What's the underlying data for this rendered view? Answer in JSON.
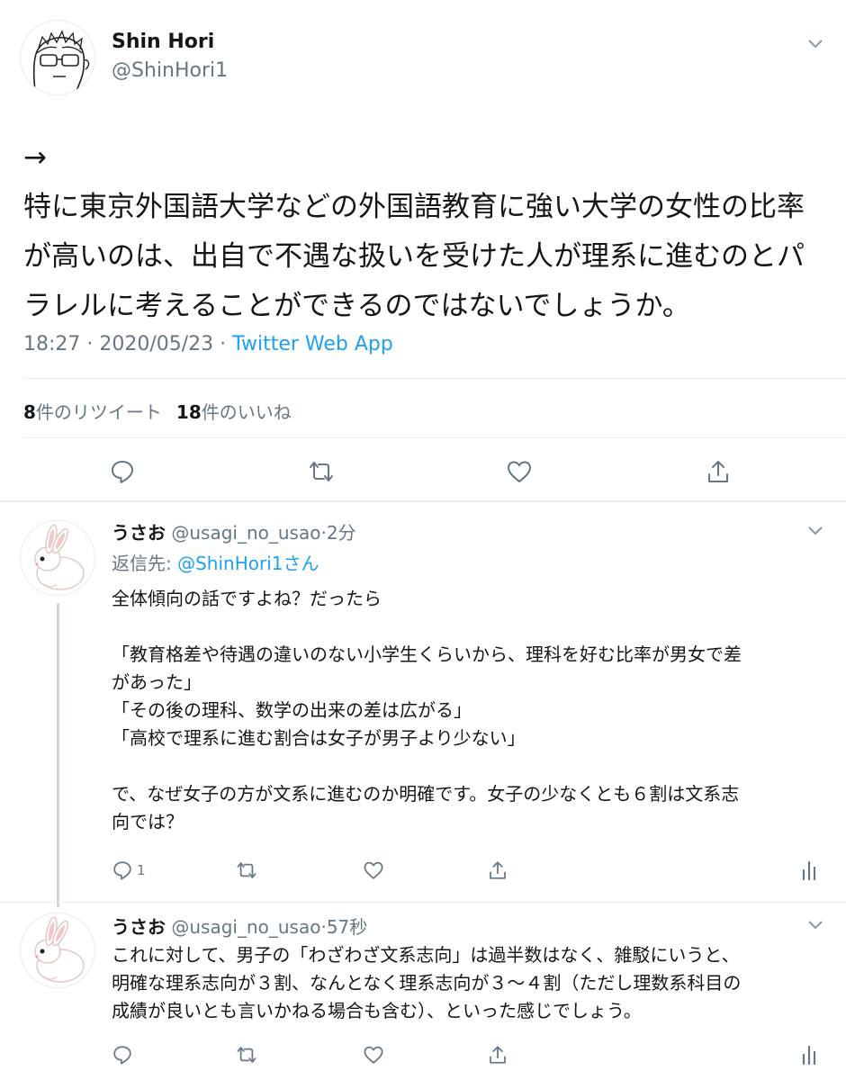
{
  "main_tweet": {
    "author_name": "Shin Hori",
    "author_handle": "@ShinHori1",
    "text_lines": [
      "→",
      "特に東京外国語大学などの外国語教育に強い大学の女性の比率",
      "が高いのは、出自で不遇な扱いを受けた人が理系に進むのとパ",
      "ラレルに考えることができるのではないでしょうか。"
    ],
    "timestamp": "18:27 · 2020/05/23 · ",
    "source_app": "Twitter Web App",
    "retweet_count": "8",
    "retweet_label": "件のリツイート",
    "like_count": "18",
    "like_label": "件のいいね"
  },
  "replies": [
    {
      "author_name": "うさお",
      "author_handle": "@usagi_no_usao",
      "time": "2分",
      "reply_to_prefix": "返信先: ",
      "reply_to_handle": "@ShinHori1さん",
      "text_lines": [
        "全体傾向の話ですよね？だったら",
        "",
        "「教育格差や待遇の違いのない小学生くらいから、理科を好む比率が男女で差",
        "があった」",
        "「その後の理科、数学の出来の差は広がる」",
        "「高校で理系に進む割合は女子が男子より少ない」",
        "",
        "で、なぜ女子の方が文系に進むのか明確です。女子の少なくとも６割は文系志",
        "向では？"
      ],
      "reply_count": "1"
    },
    {
      "author_name": "うさお",
      "author_handle": "@usagi_no_usao",
      "time": "57秒",
      "text_lines": [
        "これに対して、男子の「わざわざ文系志向」は過半数はなく、雑駁にいうと、",
        "明確な理系志向が３割、なんとなく理系志向が３～４割（ただし理数系科目の",
        "成績が良いとも言いかねる場合も含む）、といった感じでしょう。"
      ]
    }
  ],
  "icons": [
    "caret-down-icon",
    "reply-icon",
    "retweet-icon",
    "like-icon",
    "share-icon",
    "analytics-icon"
  ],
  "colors": {
    "link": "#1da1f2",
    "secondary_text": "#657786",
    "divider": "#e6ecf0"
  }
}
